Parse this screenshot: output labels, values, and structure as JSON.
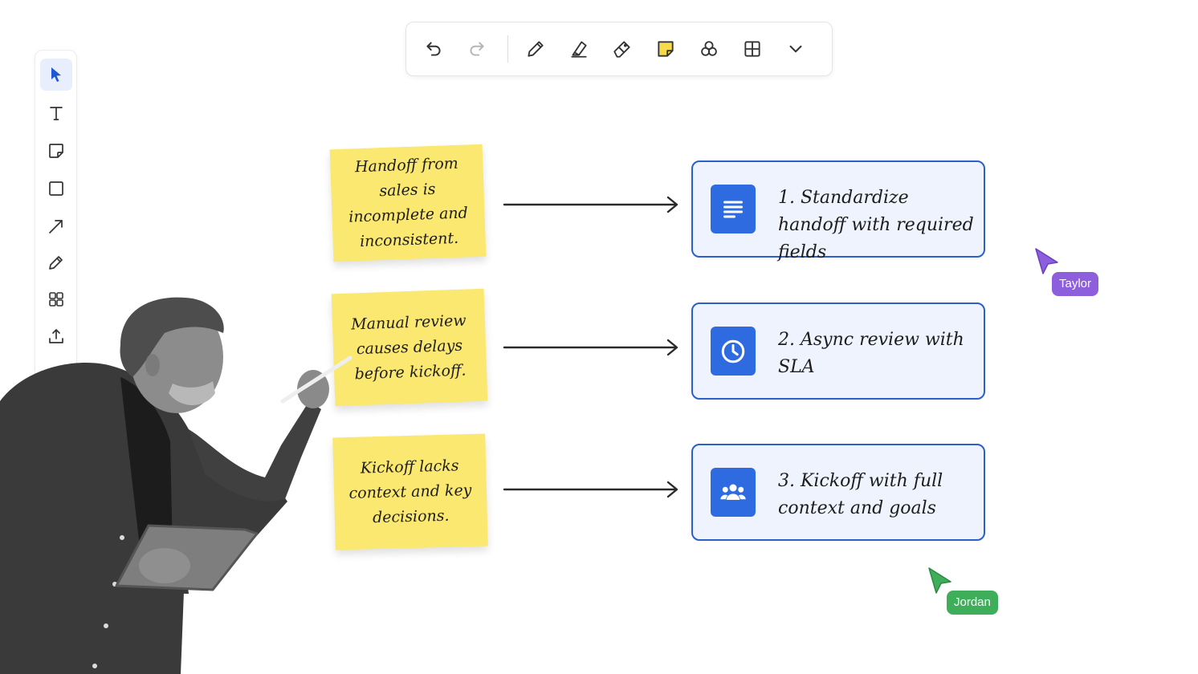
{
  "toolbar": {
    "items": [
      {
        "name": "undo-button",
        "icon": "undo-icon"
      },
      {
        "name": "redo-button",
        "icon": "redo-icon"
      },
      {
        "name": "pen-button",
        "icon": "pen-icon"
      },
      {
        "name": "highlighter-button",
        "icon": "highlighter-icon"
      },
      {
        "name": "eraser-button",
        "icon": "eraser-icon"
      },
      {
        "name": "sticky-note-button",
        "icon": "sticky-note-icon"
      },
      {
        "name": "shapes-button",
        "icon": "shapes-icon"
      },
      {
        "name": "table-button",
        "icon": "table-icon"
      },
      {
        "name": "more-tools-button",
        "icon": "chevron-down-icon"
      }
    ]
  },
  "rail": {
    "items": [
      {
        "name": "select-tool",
        "icon": "cursor-icon",
        "active": true
      },
      {
        "name": "text-tool",
        "icon": "text-icon"
      },
      {
        "name": "sticky-tool",
        "icon": "sticky-note-icon"
      },
      {
        "name": "rectangle-tool",
        "icon": "rectangle-icon"
      },
      {
        "name": "arrow-tool",
        "icon": "arrow-icon"
      },
      {
        "name": "pen-tool",
        "icon": "pencil-icon"
      },
      {
        "name": "templates-tool",
        "icon": "grid-icon"
      },
      {
        "name": "upload-tool",
        "icon": "upload-icon"
      },
      {
        "name": "more-tool",
        "icon": "more-icon"
      }
    ]
  },
  "board": {
    "problems": [
      {
        "text": "Handoff from sales is incomplete and inconsistent."
      },
      {
        "text": "Manual review causes delays before kickoff."
      },
      {
        "text": "Kickoff lacks context and key decisions."
      }
    ],
    "solutions": [
      {
        "text": "1. Standardize handoff with required fields",
        "icon": "document-icon"
      },
      {
        "text": "2. Async review with SLA",
        "icon": "clock-icon"
      },
      {
        "text": "3. Kickoff with full context and goals",
        "icon": "team-icon"
      }
    ]
  },
  "collaborators": [
    {
      "name": "Taylor",
      "color": "#8d5fdc"
    },
    {
      "name": "Jordan",
      "color": "#3fae5a"
    }
  ],
  "colors": {
    "accent": "#2f6be0",
    "sticky": "#fbe870",
    "card_fill": "#eef3fd",
    "card_border": "#2b5fc9"
  }
}
